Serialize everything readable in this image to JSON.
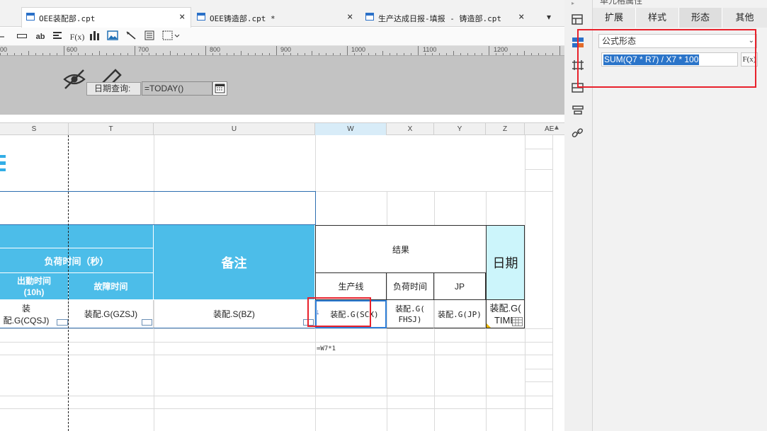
{
  "tabs": [
    {
      "label": "OEE装配部.cpt",
      "active": true
    },
    {
      "label": "OEE铸造部.cpt *",
      "active": false
    },
    {
      "label": "生产达成日报-填报 - 铸造部.cpt",
      "active": false
    }
  ],
  "toolbar": {
    "text_btn": "ab",
    "formula_btn": "F(x)"
  },
  "ruler": {
    "labels": [
      "600",
      "700",
      "800",
      "900",
      "1000",
      "1100",
      "1200"
    ],
    "left_partial": "00"
  },
  "param": {
    "date_label": "日期查询:",
    "date_value": "=TODAY()"
  },
  "columns": [
    "S",
    "T",
    "U",
    "W",
    "X",
    "Y",
    "Z",
    "AE"
  ],
  "sheet": {
    "load_time": "负荷时间（秒）",
    "remark": "备注",
    "result": "结果",
    "date": "日期",
    "attend_time": "出勤时间\n(10h)",
    "fault_time": "故障时间",
    "prod_line": "生产线",
    "load_time_short": "负荷时间",
    "jp": "JP",
    "cell_cqsj": "装配.G(CQSJ)",
    "cell_gzsj": "装配.G(GZSJ)",
    "cell_bz": "装配.S(BZ)",
    "cell_scx": "装配.G(SCX)",
    "cell_fhsj": "装配.G(\nFHSJ)",
    "cell_jp": "装配.G(JP)",
    "cell_time": "装配.G(\nTIME",
    "formula_cell": "=W7*1"
  },
  "panel": {
    "title": "单元格属性",
    "tabs": [
      "扩展",
      "样式",
      "形态",
      "其他"
    ],
    "active_tab": "形态",
    "form_select": "公式形态",
    "formula": "SUM(Q7 * R7) / X7 * 100",
    "fx_button": "F(x)"
  },
  "colors": {
    "accent": "#4cbde9",
    "highlight": "#e8212b",
    "selection": "#2f7fd8"
  }
}
